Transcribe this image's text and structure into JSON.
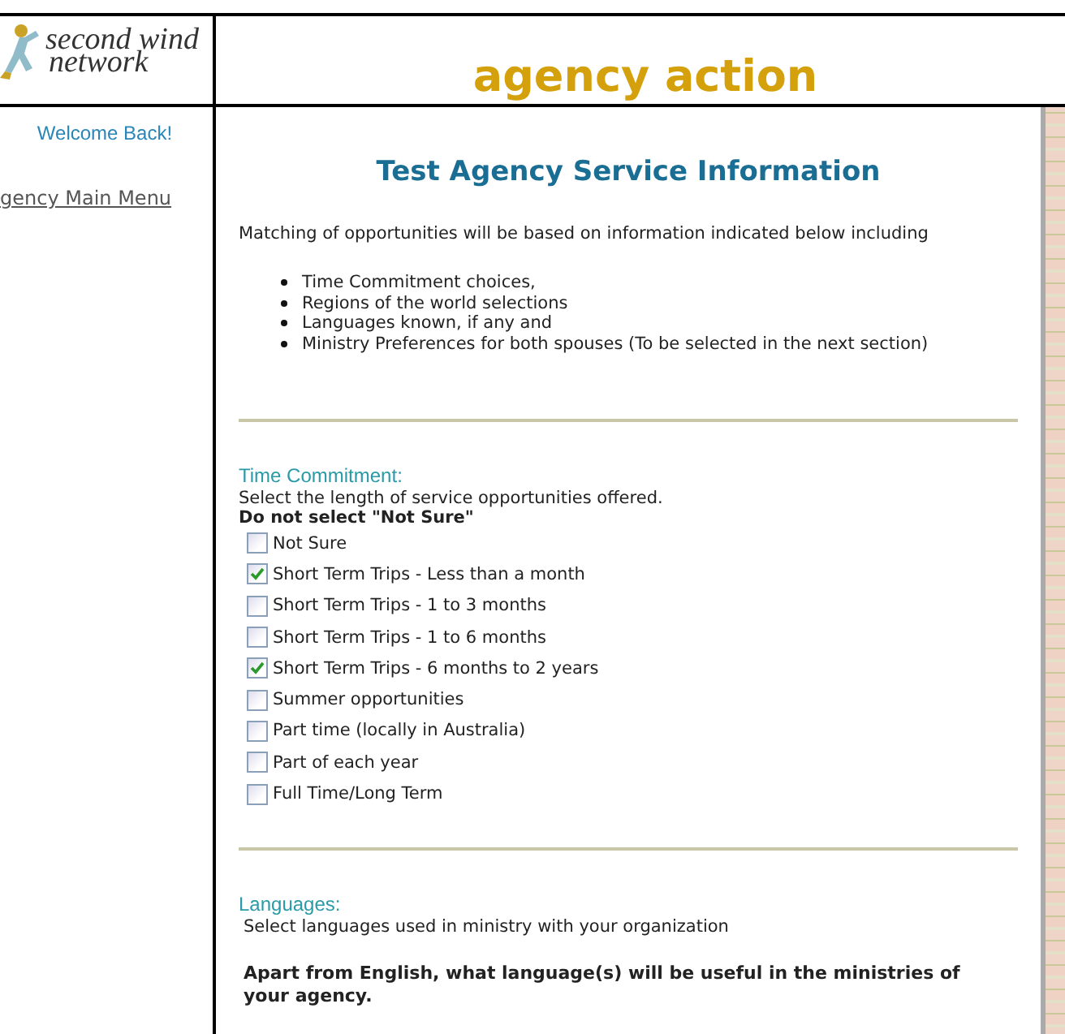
{
  "logo": {
    "line_1": "second wind",
    "line_2": "network"
  },
  "header": {
    "title": "agency action"
  },
  "sidebar": {
    "welcome": "Welcome Back!",
    "links": [
      "gency Main Menu"
    ]
  },
  "main": {
    "heading": "Test Agency Service Information",
    "intro": "Matching of opportunities will be based on information indicated below including",
    "bullets": [
      "Time Commitment choices,",
      "Regions of the world selections",
      "Languages known, if any and",
      "Ministry Preferences for both spouses (To be selected in the next section)"
    ],
    "time_commitment": {
      "label": "Time Commitment:",
      "instruction": "Select the length of service opportunities offered.",
      "warning": "Do not select \"Not Sure\"",
      "options": [
        {
          "label": "Not Sure",
          "checked": false
        },
        {
          "label": "Short Term Trips - Less than a month",
          "checked": true
        },
        {
          "label": "Short Term Trips - 1 to 3 months",
          "checked": false
        },
        {
          "label": "Short Term Trips - 1 to 6 months",
          "checked": false
        },
        {
          "label": "Short Term Trips - 6 months to 2 years",
          "checked": true
        },
        {
          "label": "Summer opportunities",
          "checked": false
        },
        {
          "label": "Part time (locally in Australia)",
          "checked": false
        },
        {
          "label": "Part of each year",
          "checked": false
        },
        {
          "label": "Full Time/Long Term",
          "checked": false
        }
      ]
    },
    "languages": {
      "label": "Languages:",
      "instruction": "Select languages used in ministry with your organization",
      "question": "Apart from English, what language(s) will be useful in the ministries of your agency."
    }
  }
}
